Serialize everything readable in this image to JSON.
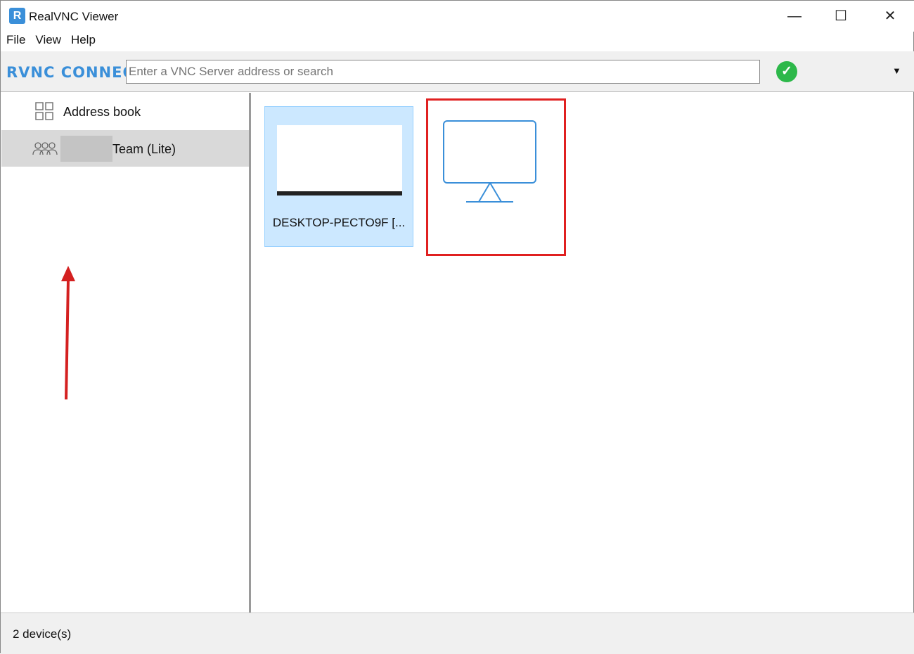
{
  "window": {
    "title": "RealVNC Viewer",
    "app_icon_text": "R"
  },
  "menu": [
    "File",
    "View",
    "Help"
  ],
  "toolbar": {
    "logo": "RVNC CONNECT",
    "search_placeholder": "Enter a VNC Server address or search",
    "status": "connected"
  },
  "sidebar": {
    "items": [
      {
        "label": "Address book"
      },
      {
        "label": "Team (Lite)"
      }
    ]
  },
  "devices": [
    {
      "name": "DESKTOP-PECTO9F [..."
    },
    {
      "name": ""
    }
  ],
  "statusbar": {
    "text": "2 device(s)"
  },
  "colors": {
    "accent": "#3a8fd9",
    "selection": "#cce8ff",
    "highlight": "#e02020",
    "ok": "#2db84a"
  }
}
